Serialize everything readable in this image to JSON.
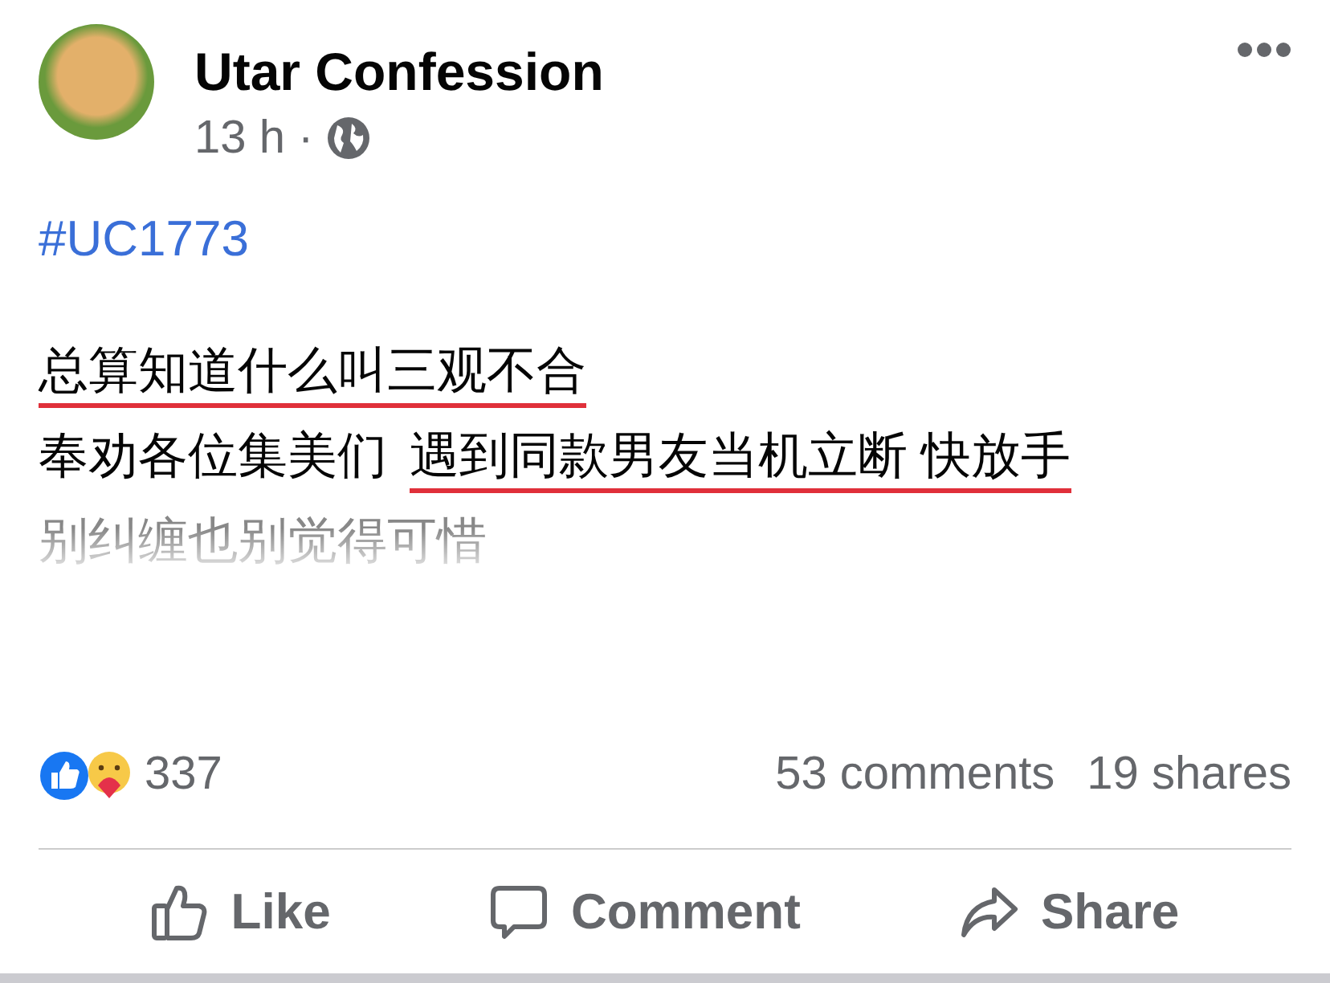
{
  "post": {
    "author": "Utar Confession",
    "time": "13 h",
    "separator": "·",
    "hashtag": "#UC1773",
    "lines": [
      {
        "faded": false,
        "segments": [
          {
            "text": "总算知道什么叫三观不合",
            "underlined": true
          }
        ]
      },
      {
        "faded": false,
        "segments": [
          {
            "text": "奉劝各位集美们",
            "underlined": false
          },
          {
            "text": "遇到同款男友当机立断 快放手",
            "underlined": true
          }
        ]
      },
      {
        "faded": true,
        "segments": [
          {
            "text": "别纠缠也别觉得可惜",
            "underlined": false
          }
        ]
      }
    ],
    "reaction_count": "337",
    "comments": "53 comments",
    "shares": "19 shares",
    "actions": [
      {
        "kind": "like",
        "label": "Like"
      },
      {
        "kind": "comment",
        "label": "Comment"
      },
      {
        "kind": "share",
        "label": "Share"
      }
    ]
  }
}
